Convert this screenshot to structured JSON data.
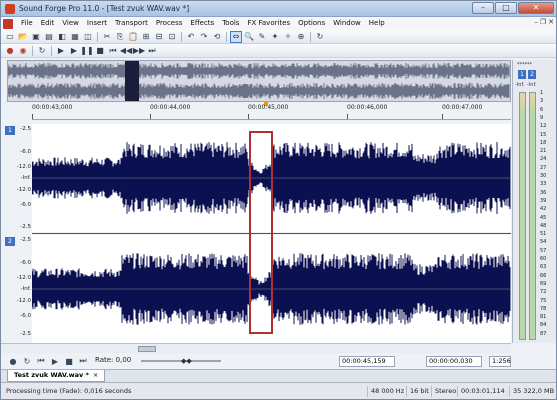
{
  "window": {
    "title": "Sound Forge Pro 11.0 - [Test zvuk WAV.wav *]"
  },
  "menu": {
    "items": [
      "File",
      "Edit",
      "View",
      "Insert",
      "Transport",
      "Process",
      "Effects",
      "Tools",
      "FX Favorites",
      "Options",
      "Window",
      "Help"
    ]
  },
  "ruler": {
    "ticks": [
      "00:00:43,000",
      "00:00:44,000",
      "00:00:45,000",
      "00:00:46,000",
      "00:00:47,000"
    ]
  },
  "channels": [
    {
      "label": "1",
      "scale": [
        "-2.5",
        "-6.0",
        "-12.0",
        "-Inf.",
        "-12.0",
        "-6.0",
        "-2.5"
      ]
    },
    {
      "label": "2",
      "scale": [
        "-2.5",
        "-6.0",
        "-12.0",
        "-Inf.",
        "-12.0",
        "-6.0",
        "-2.5"
      ]
    }
  ],
  "meters": {
    "header": "******",
    "channels": [
      "1",
      "2"
    ],
    "peak": [
      "-Inf.",
      "-Inf."
    ],
    "scale": [
      "1",
      "3",
      "6",
      "9",
      "12",
      "15",
      "18",
      "21",
      "24",
      "27",
      "30",
      "33",
      "36",
      "39",
      "42",
      "45",
      "48",
      "51",
      "54",
      "57",
      "60",
      "63",
      "66",
      "69",
      "72",
      "75",
      "78",
      "81",
      "84",
      "87"
    ]
  },
  "transport": {
    "rate": "Rate: 0,00",
    "cursor_position": "00:00:45,159",
    "selection_length": "00:00:00,030",
    "zoom": "1:256"
  },
  "doc_tab": {
    "label": "Test zvuk WAV.wav *",
    "close": "×"
  },
  "status": {
    "message": "Processing time (Fade): 0,016 seconds",
    "sample_rate": "48 000 Hz",
    "bit_depth": "16 bit",
    "channels": "Stereo",
    "duration": "00:03:01,114",
    "disk_space": "35 322,0 MB"
  },
  "colors": {
    "waveform": "#0b1150",
    "selection": "#b03030",
    "channel_label": "#3f6fc2"
  }
}
